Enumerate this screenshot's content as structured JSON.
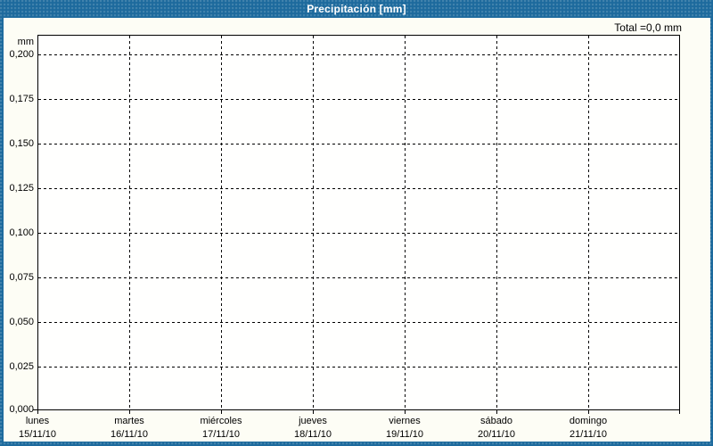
{
  "window": {
    "title": "Precipitación [mm]"
  },
  "summary": {
    "total": "Total =0,0 mm"
  },
  "y_axis": {
    "unit": "mm",
    "ticks": [
      "0,200",
      "0,175",
      "0,150",
      "0,125",
      "0,100",
      "0,075",
      "0,050",
      "0,025",
      "0,000"
    ]
  },
  "x_axis": {
    "days": [
      {
        "name": "lunes",
        "date": "15/11/10"
      },
      {
        "name": "martes",
        "date": "16/11/10"
      },
      {
        "name": "miércoles",
        "date": "17/11/10"
      },
      {
        "name": "jueves",
        "date": "18/11/10"
      },
      {
        "name": "viernes",
        "date": "19/11/10"
      },
      {
        "name": "sábado",
        "date": "20/11/10"
      },
      {
        "name": "domingo",
        "date": "21/11/10"
      }
    ]
  },
  "colors": {
    "frame_blue": "#1d6a9d",
    "panel_bg": "#fdfdf5",
    "plot_bg": "#fffffe",
    "grid": "#000000",
    "title_text": "#ffffff"
  },
  "chart_data": {
    "type": "bar",
    "title": "Precipitación [mm]",
    "ylabel": "mm",
    "ylim": [
      0,
      0.2
    ],
    "y_tick_step": 0.025,
    "categories": [
      "lunes 15/11/10",
      "martes 16/11/10",
      "miércoles 17/11/10",
      "jueves 18/11/10",
      "viernes 19/11/10",
      "sábado 20/11/10",
      "domingo 21/11/10"
    ],
    "values": [
      0,
      0,
      0,
      0,
      0,
      0,
      0
    ],
    "total_label": "Total =0,0 mm",
    "grid": "dashed",
    "legend": "none",
    "notes": "empty precipitation chart, no bars drawn, weekly span 15/11/10-21/11/10"
  }
}
